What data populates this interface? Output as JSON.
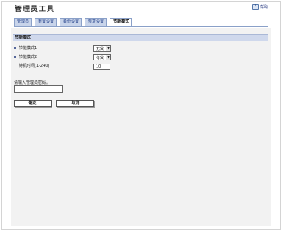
{
  "header": {
    "title": "管理员工具",
    "help_label": "帮助",
    "help_icon": "help-icon"
  },
  "tabs": [
    {
      "label": "管理员",
      "active": false
    },
    {
      "label": "重置设置",
      "active": false
    },
    {
      "label": "备份设置",
      "active": false
    },
    {
      "label": "恢复设置",
      "active": false
    },
    {
      "label": "节能模式",
      "active": true
    }
  ],
  "section": {
    "title": "节能模式"
  },
  "settings": {
    "mode1_label": "节能模式1",
    "mode1_value": "无效",
    "mode2_label": "节能模式2",
    "mode2_value": "有效",
    "wait_label": "待机时间(1-240)",
    "wait_value": "10"
  },
  "password": {
    "label": "请输入管理员密码。",
    "value": ""
  },
  "buttons": {
    "ok": "确定",
    "cancel": "取消"
  },
  "colors": {
    "tab_bg": "#c8d4ea",
    "section_header_bg": "#cfd8ec",
    "panel_bg": "#f2f2f2"
  }
}
